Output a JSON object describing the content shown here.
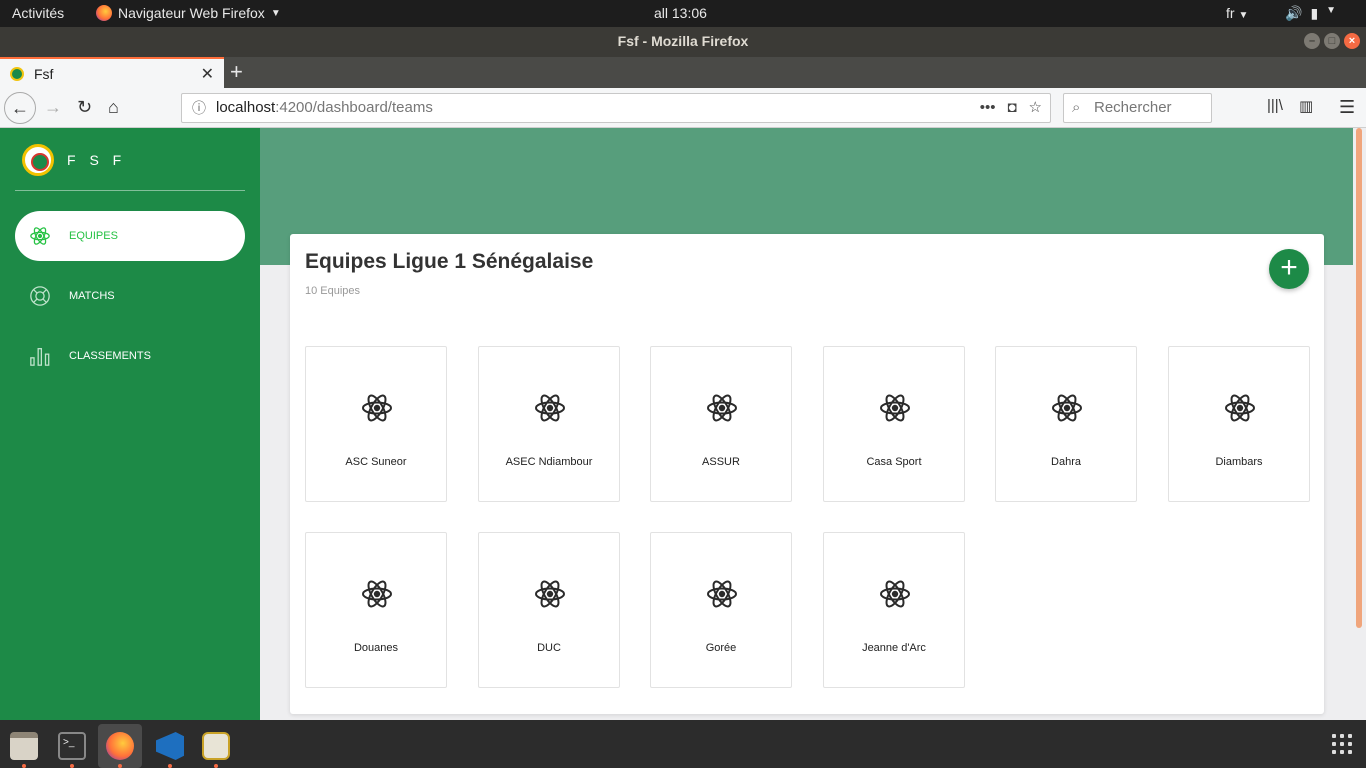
{
  "system_bar": {
    "activities": "Activités",
    "app_menu": "Navigateur Web Firefox",
    "clock": "all 13:06",
    "language": "fr"
  },
  "window": {
    "title": "Fsf - Mozilla Firefox"
  },
  "browser": {
    "tab_title": "Fsf",
    "url_host": "localhost",
    "url_path": ":4200/dashboard/teams",
    "search_placeholder": "Rechercher"
  },
  "sidebar": {
    "brand": "F S F",
    "items": [
      {
        "label": "EQUIPES",
        "icon": "atom-icon",
        "active": true
      },
      {
        "label": "MATCHS",
        "icon": "lifebuoy-icon",
        "active": false
      },
      {
        "label": "CLASSEMENTS",
        "icon": "bar-chart-icon",
        "active": false
      }
    ]
  },
  "main": {
    "title": "Equipes Ligue 1 Sénégalaise",
    "subtitle": "10 Equipes",
    "add_button": "+",
    "teams": [
      "ASC Suneor",
      "ASEC Ndiambour",
      "ASSUR",
      "Casa Sport",
      "Dahra",
      "Diambars",
      "Douanes",
      "DUC",
      "Gorée",
      "Jeanne d'Arc"
    ]
  },
  "colors": {
    "sidebar": "#1d8a47",
    "banner": "#579e7c",
    "active_text": "#26c244"
  },
  "dock": {
    "apps": [
      "files-icon",
      "terminal-icon",
      "firefox-icon",
      "vscode-icon",
      "software-icon"
    ]
  }
}
